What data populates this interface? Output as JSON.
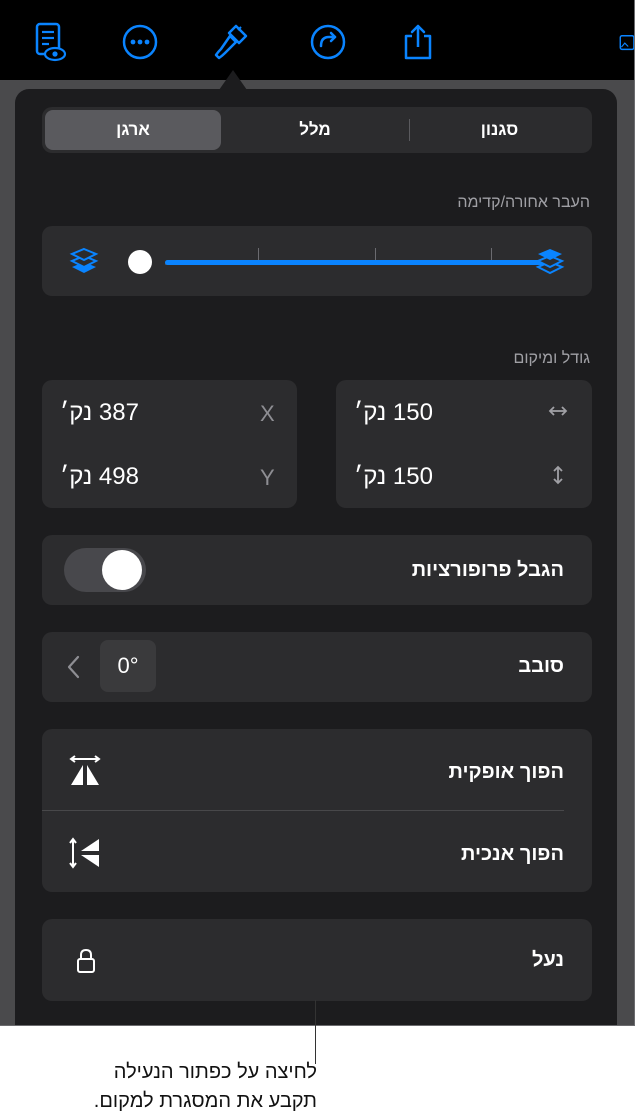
{
  "toolbar": {
    "icons": [
      "reader-view-icon",
      "more-icon",
      "format-paintbrush-icon",
      "redo-icon",
      "share-icon",
      "media-icon"
    ]
  },
  "tabs": {
    "style": "סגנון",
    "text": "מלל",
    "arrange": "ארגן",
    "selected": "ארגן"
  },
  "backfront": {
    "label": "העבר אחורה/קדימה",
    "slider_value": 0
  },
  "size_position": {
    "label": "גודל ומיקום",
    "width": "150 נק׳",
    "height": "150 נק׳",
    "x_label": "X",
    "x": "387 נק׳",
    "y_label": "Y",
    "y": "498 נק׳"
  },
  "constrain": {
    "label": "הגבל פרופורציות",
    "on": false
  },
  "rotate": {
    "label": "סובב",
    "value": "0°"
  },
  "flip": {
    "horizontal": "הפוך אופקית",
    "vertical": "הפוך אנכית"
  },
  "lock": {
    "label": "נעל"
  },
  "caption": {
    "line1": "לחיצה על כפתור הנעילה",
    "line2": "תקבע את המסגרת למקום."
  },
  "colors": {
    "accent": "#0a84ff",
    "panel": "#1c1c1e",
    "card": "#2c2c2e"
  }
}
